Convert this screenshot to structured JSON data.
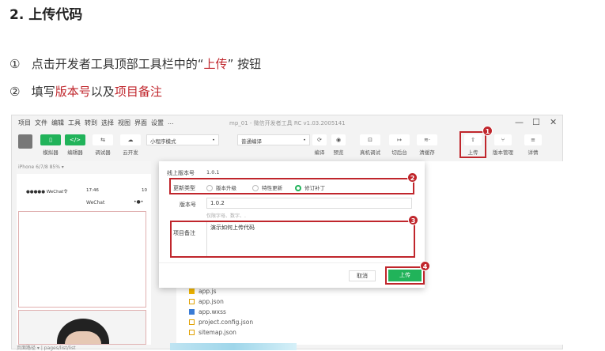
{
  "heading": "2. 上传代码",
  "steps": [
    {
      "num": "①",
      "pre": "点击开发者工具顶部工具栏中的“",
      "hl": "上传",
      "post": "” 按钮"
    },
    {
      "num": "②",
      "pre": "填写",
      "hl": "版本号",
      "mid": "以及",
      "hl2": "项目备注"
    }
  ],
  "window": {
    "menu": [
      "项目",
      "文件",
      "编辑",
      "工具",
      "转到",
      "选择",
      "视图",
      "界面",
      "设置",
      "..."
    ],
    "title": "mp_01 - 微信开发者工具 RC v1.03.2005141",
    "toolbar_left": [
      {
        "icon": "phone-icon",
        "label": "模拟器"
      },
      {
        "icon": "code-icon",
        "label": "编辑器"
      },
      {
        "icon": "debug-icon",
        "label": "调试器"
      },
      {
        "icon": "cloud-icon",
        "label": "云开发"
      }
    ],
    "mode_select": "小程序模式",
    "compile_select": "普通编译",
    "toolbar_mid": [
      {
        "icon": "refresh-icon",
        "label": "编译"
      },
      {
        "icon": "eye-icon",
        "label": "预览"
      },
      {
        "icon": "device-icon",
        "label": "真机调试"
      },
      {
        "icon": "background-icon",
        "label": "切后台"
      },
      {
        "icon": "cache-icon",
        "label": "清缓存"
      }
    ],
    "toolbar_right": [
      {
        "icon": "upload-icon",
        "label": "上传"
      },
      {
        "icon": "branch-icon",
        "label": "版本管理"
      },
      {
        "icon": "menu-icon",
        "label": "详情"
      }
    ],
    "sim": {
      "device": "iPhone 6/7/8 85% ▾",
      "carrier": "●●●●● WeChat令",
      "time": "17:46",
      "batt": "10",
      "nav_title": "WeChat",
      "dots": "•●•"
    },
    "status": {
      "left": "页面路径 ▾",
      "path": "pages/list/list"
    },
    "files": [
      "app.js",
      "app.json",
      "app.wxss",
      "project.config.json",
      "sitemap.json"
    ]
  },
  "dialog": {
    "online_label": "线上版本号",
    "online_value": "1.0.1",
    "type_label": "更新类型",
    "types": [
      "版本升级",
      "特性更新",
      "修订补丁"
    ],
    "selected_type": 2,
    "version_label": "版本号",
    "version_value": "1.0.2",
    "version_hint": "仅限字母、数字、.",
    "note_label": "项目备注",
    "note_value": "演示如何上传代码",
    "cancel": "取消",
    "upload": "上传"
  },
  "badges": [
    "1",
    "2",
    "3",
    "4"
  ],
  "colors": {
    "accent": "#21b35a",
    "highlight": "#c0262c"
  }
}
